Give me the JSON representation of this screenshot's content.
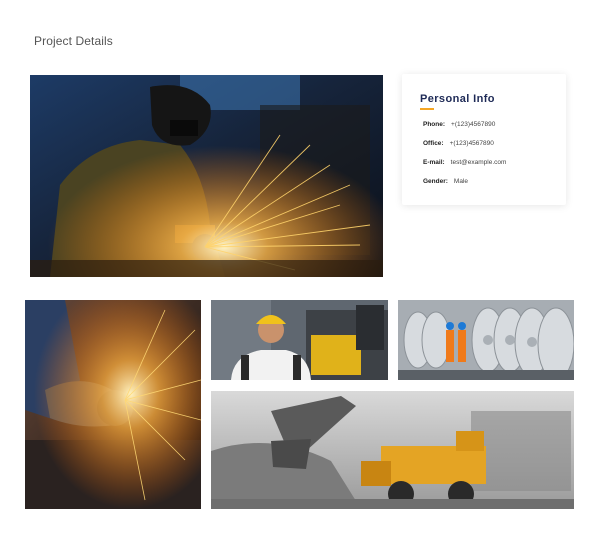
{
  "page": {
    "title": "Project Details"
  },
  "personal_info": {
    "title": "Personal Info",
    "accent_color": "#f5a623",
    "rows": [
      {
        "key": "Phone:",
        "value": "+(123)4567890"
      },
      {
        "key": "Office:",
        "value": "+(123)4567890"
      },
      {
        "key": "E-mail:",
        "value": "test@example.com"
      },
      {
        "key": "Gender:",
        "value": "Male"
      }
    ]
  },
  "gallery": [
    {
      "name": "welder-grinding-sparks-photo"
    },
    {
      "name": "angle-grinder-sparks-photo"
    },
    {
      "name": "smiling-worker-hardhat-photo"
    },
    {
      "name": "steel-coils-workers-photo"
    },
    {
      "name": "mining-truck-excavator-photo"
    }
  ]
}
